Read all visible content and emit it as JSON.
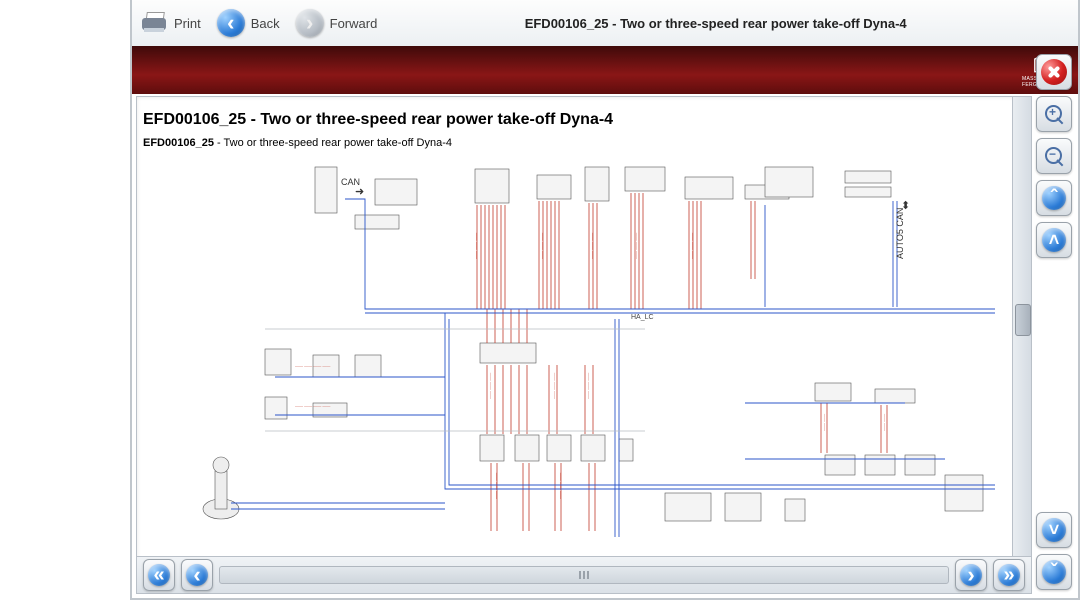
{
  "toolbar": {
    "print_label": "Print",
    "back_label": "Back",
    "forward_label": "Forward",
    "title": "EFD00106_25 - Two or three-speed rear power take-off Dyna-4"
  },
  "brand": {
    "name": "MASSEY FERGUSON"
  },
  "page": {
    "heading": "EFD00106_25 - Two or three-speed rear power take-off Dyna-4",
    "sub_code": "EFD00106_25",
    "sub_desc": " - Two or three-speed rear power take-off Dyna-4"
  },
  "diagram": {
    "labels": {
      "can": "CAN",
      "autocan": "AUTO5 CAN",
      "ha_lc": "HA_LC"
    }
  }
}
